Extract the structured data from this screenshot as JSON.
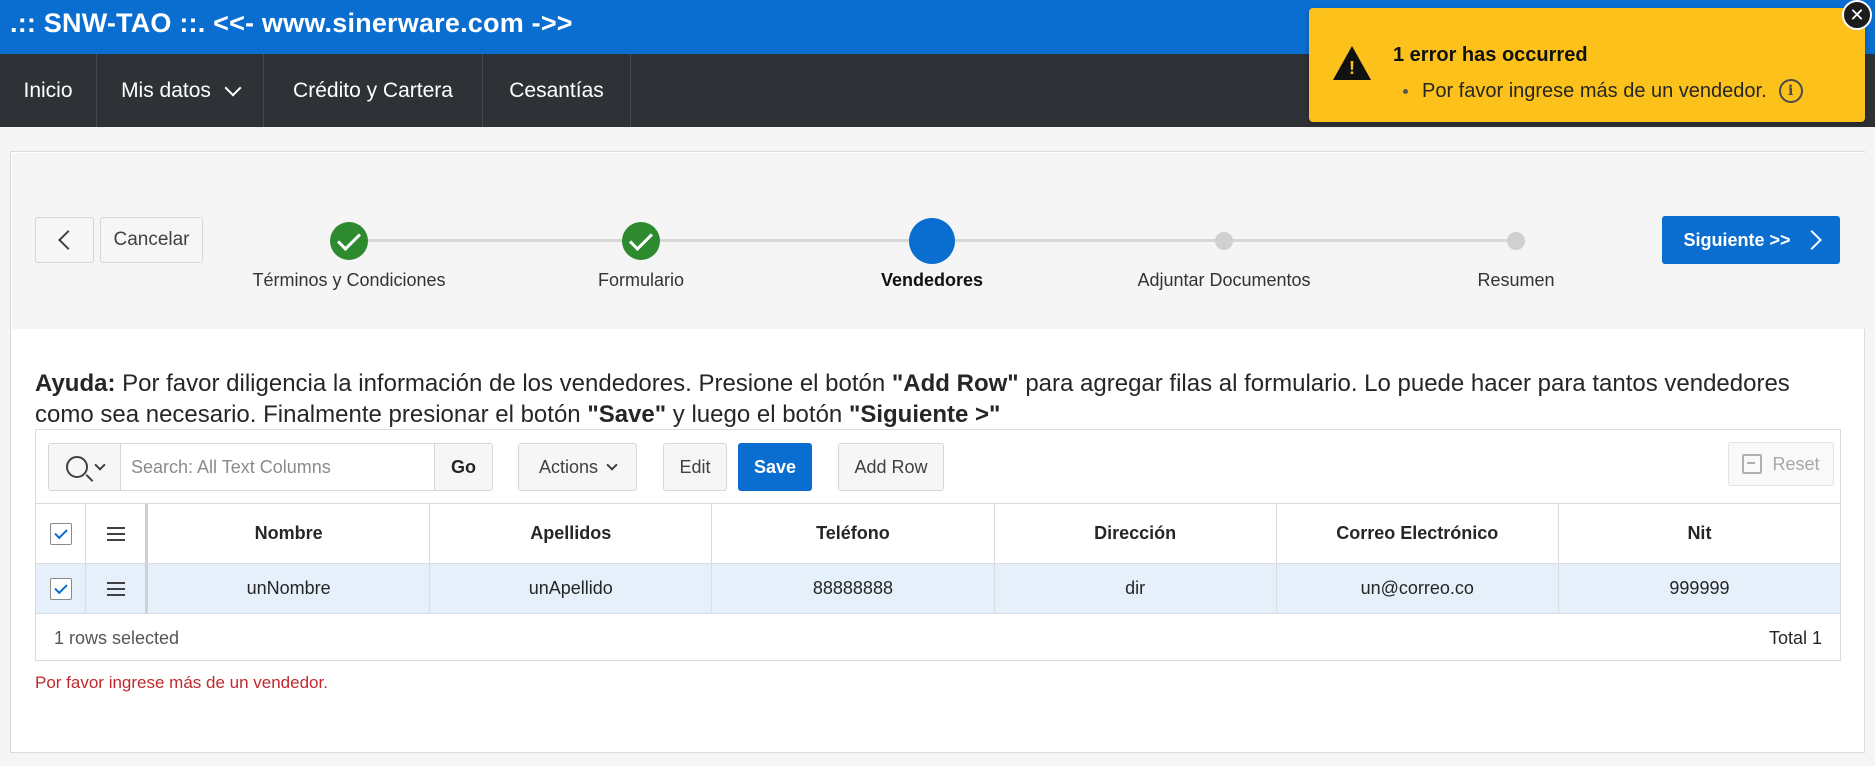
{
  "app": {
    "title": ".:: SNW-TAO ::. <<- www.sinerware.com ->>"
  },
  "nav": {
    "items": [
      {
        "label": "Inicio"
      },
      {
        "label": "Mis datos"
      },
      {
        "label": "Crédito y Cartera"
      },
      {
        "label": "Cesantías"
      }
    ]
  },
  "wizard": {
    "cancel_label": "Cancelar",
    "next_label": "Siguiente >>",
    "steps": [
      {
        "label": "Términos y Condiciones",
        "state": "complete"
      },
      {
        "label": "Formulario",
        "state": "complete"
      },
      {
        "label": "Vendedores",
        "state": "current"
      },
      {
        "label": "Adjuntar Documentos",
        "state": "pending"
      },
      {
        "label": "Resumen",
        "state": "pending"
      }
    ]
  },
  "help": {
    "label": "Ayuda:",
    "text1": " Por favor diligencia la información de los vendedores. Presione el botón ",
    "bold1": "\"Add Row\"",
    "text2": " para agregar filas al formulario. Lo puede hacer para tantos vendedores como sea necesario. Finalmente presionar el botón ",
    "bold2": "\"Save\"",
    "text3": " y luego el botón ",
    "bold3": "\"Siguiente >\""
  },
  "grid": {
    "search_placeholder": "Search: All Text Columns",
    "go_label": "Go",
    "actions_label": "Actions",
    "edit_label": "Edit",
    "save_label": "Save",
    "add_row_label": "Add Row",
    "reset_label": "Reset",
    "columns": [
      "Nombre",
      "Apellidos",
      "Teléfono",
      "Dirección",
      "Correo Electrónico",
      "Nit"
    ],
    "rows": [
      [
        "unNombre",
        "unApellido",
        "88888888",
        "dir",
        "un@correo.co",
        "999999"
      ]
    ],
    "selected_text": "1 rows selected",
    "total_text": "Total 1"
  },
  "inline_error": "Por favor ingrese más de un vendedor.",
  "notification": {
    "title": "1 error has occurred",
    "message": "Por favor ingrese más de un vendedor.",
    "close_symbol": "✕",
    "info_symbol": "i"
  },
  "colors": {
    "brand": "#0a6ed1",
    "nav_bg": "#2e3237",
    "success": "#2e8a2e",
    "warning": "#fcc21b",
    "error_text": "#c0292e"
  }
}
